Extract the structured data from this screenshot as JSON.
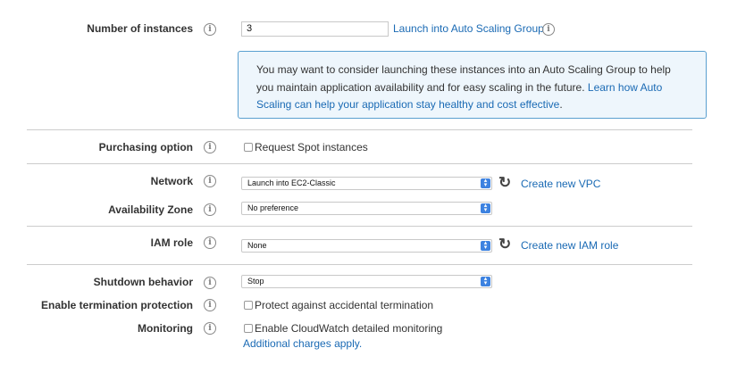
{
  "instances": {
    "label": "Number of instances",
    "value": "3",
    "asg_link": "Launch into Auto Scaling Group"
  },
  "notice": {
    "text": "You may want to consider launching these instances into an Auto Scaling Group to help you maintain application availability and for easy scaling in the future.",
    "link": "Learn how Auto Scaling can help your application stay healthy and cost effective",
    "suffix": "."
  },
  "purchasing": {
    "label": "Purchasing option",
    "checkbox_label": "Request Spot instances",
    "checked": false
  },
  "network": {
    "label": "Network",
    "selected": "Launch into EC2-Classic",
    "create_link": "Create new VPC"
  },
  "availability_zone": {
    "label": "Availability Zone",
    "selected": "No preference"
  },
  "iam_role": {
    "label": "IAM role",
    "selected": "None",
    "create_link": "Create new IAM role"
  },
  "shutdown": {
    "label": "Shutdown behavior",
    "selected": "Stop"
  },
  "termination": {
    "label": "Enable termination protection",
    "checkbox_label": "Protect against accidental termination",
    "checked": false
  },
  "monitoring": {
    "label": "Monitoring",
    "checkbox_label": "Enable CloudWatch detailed monitoring",
    "checked": false,
    "charges_link": "Additional charges apply."
  },
  "icons": {
    "info": "info-icon",
    "refresh": "refresh-icon",
    "select_arrow": "select-arrows-icon"
  },
  "colors": {
    "link": "#1a6ab4",
    "notice_border": "#5aa0d0",
    "notice_bg": "#eef6fc",
    "select_accent": "#3d82e0"
  }
}
